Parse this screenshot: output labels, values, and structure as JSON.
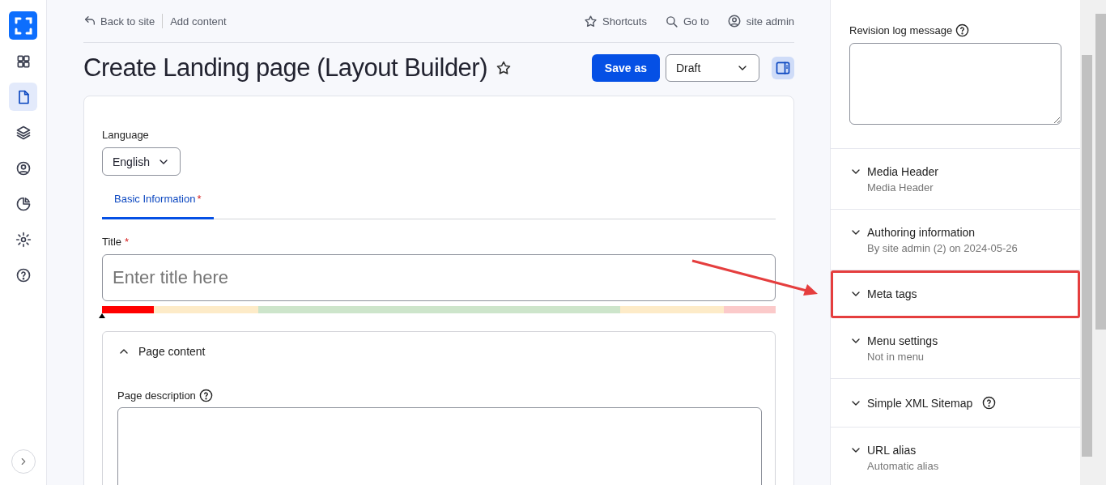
{
  "sidebar": {
    "items": [
      {
        "selected": false
      },
      {
        "selected": true
      },
      {
        "selected": false
      },
      {
        "selected": false
      },
      {
        "selected": false
      },
      {
        "selected": false
      },
      {
        "selected": false
      }
    ]
  },
  "topbar": {
    "back_link": "Back to site",
    "add_content": "Add content",
    "shortcuts": "Shortcuts",
    "go_to": "Go to",
    "user": "site admin"
  },
  "page_title": "Create Landing page (Layout Builder)",
  "save_button": "Save as",
  "status_select": {
    "value": "Draft"
  },
  "language": {
    "label": "Language",
    "value": "English"
  },
  "tabs": [
    {
      "label": "Basic Information",
      "required_mark": "*",
      "selected": true
    }
  ],
  "title_field": {
    "label": "Title",
    "required_mark": "*",
    "placeholder": "Enter title here",
    "level": 0
  },
  "page_content": {
    "heading": "Page content",
    "expanded": true,
    "description_label": "Page description"
  },
  "side_panel": {
    "revision_label": "Revision log message",
    "sections": [
      {
        "title": "Media Header",
        "summary": "Media Header",
        "help": false,
        "highlighted": false
      },
      {
        "title": "Authoring information",
        "summary": "By site admin (2) on 2024-05-26",
        "help": false,
        "highlighted": false
      },
      {
        "title": "Meta tags",
        "help": false,
        "highlighted": true
      },
      {
        "title": "Menu settings",
        "summary": "Not in menu",
        "help": false,
        "highlighted": false
      },
      {
        "title": "Simple XML Sitemap",
        "help": true,
        "highlighted": false
      },
      {
        "title": "URL alias",
        "summary": "Automatic alias",
        "help": false,
        "highlighted": false
      }
    ]
  }
}
